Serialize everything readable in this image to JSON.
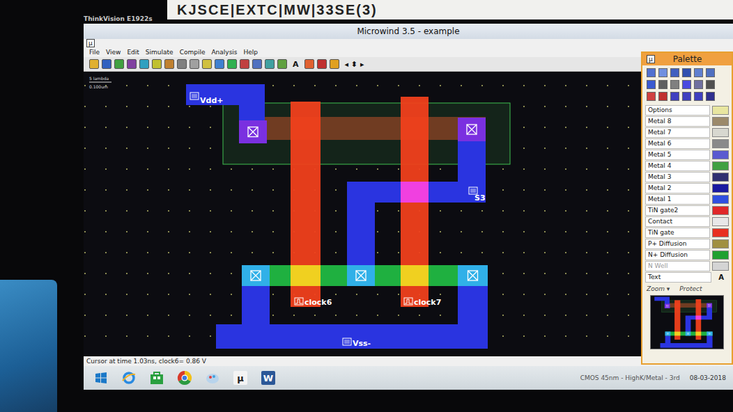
{
  "monitor": {
    "brand": "ThinkVision E1922s",
    "sticker": "KJSCE|EXTC|MW|33SE(3)"
  },
  "window": {
    "title": "Microwind 3.5 - example",
    "app_icon": "µ"
  },
  "menu": [
    "File",
    "View",
    "Edit",
    "Simulate",
    "Compile",
    "Analysis",
    "Help"
  ],
  "toolbar": [
    {
      "kind": "icon",
      "color": "#e0b030"
    },
    {
      "kind": "icon",
      "color": "#3060c0"
    },
    {
      "kind": "icon",
      "color": "#40a040"
    },
    {
      "kind": "icon",
      "color": "#8040a0"
    },
    {
      "kind": "icon",
      "color": "#30a0c0"
    },
    {
      "kind": "icon",
      "color": "#c0c030"
    },
    {
      "kind": "icon",
      "color": "#c08030"
    },
    {
      "kind": "icon",
      "color": "#808080"
    },
    {
      "kind": "icon",
      "color": "#a0a0a0"
    },
    {
      "kind": "icon",
      "color": "#d0c040"
    },
    {
      "kind": "icon",
      "color": "#4080d0"
    },
    {
      "kind": "icon",
      "color": "#30b050"
    },
    {
      "kind": "icon",
      "color": "#c04040"
    },
    {
      "kind": "icon",
      "color": "#5070c0"
    },
    {
      "kind": "icon",
      "color": "#40a0a0"
    },
    {
      "kind": "icon",
      "color": "#60a040"
    },
    {
      "kind": "text",
      "label": "A"
    },
    {
      "kind": "icon",
      "color": "#e06030"
    },
    {
      "kind": "icon",
      "color": "#c03030"
    },
    {
      "kind": "icon",
      "color": "#e0a020"
    },
    {
      "kind": "text",
      "label": "◂ ⬍ ▸"
    }
  ],
  "scale": {
    "lambda": "5 lambda",
    "length": "0.100um"
  },
  "labels": {
    "vdd": "Vdd+",
    "s3": "S3",
    "clock6": "clock6",
    "clock7": "clock7",
    "vss": "Vss-"
  },
  "palette": {
    "title": "Palette",
    "items": [
      {
        "name": "Options",
        "kind": "color",
        "color": "#e8e6a0",
        "disabled": false
      },
      {
        "name": "Metal 8",
        "kind": "color",
        "color": "#9c8a6a",
        "disabled": false
      },
      {
        "name": "Metal 7",
        "kind": "color",
        "color": "#d8d8d0",
        "disabled": false
      },
      {
        "name": "Metal 6",
        "kind": "color",
        "color": "#8a8a8a",
        "disabled": false
      },
      {
        "name": "Metal 5",
        "kind": "color",
        "color": "#5a5ad0",
        "disabled": false
      },
      {
        "name": "Metal 4",
        "kind": "color",
        "color": "#40a040",
        "disabled": false
      },
      {
        "name": "Metal 3",
        "kind": "color",
        "color": "#303070",
        "disabled": false
      },
      {
        "name": "Metal 2",
        "kind": "color",
        "color": "#1a1aa0",
        "disabled": false
      },
      {
        "name": "Metal 1",
        "kind": "color",
        "color": "#3050e0",
        "disabled": false
      },
      {
        "name": "TiN gate2",
        "kind": "color",
        "color": "#e02828",
        "disabled": false
      },
      {
        "name": "Contact",
        "kind": "color",
        "color": "#e8e8e8",
        "disabled": false
      },
      {
        "name": "TiN gate",
        "kind": "color",
        "color": "#e83020",
        "disabled": false
      },
      {
        "name": "P+ Diffusion",
        "kind": "color",
        "color": "#a09040",
        "disabled": false
      },
      {
        "name": "N+ Diffusion",
        "kind": "color",
        "color": "#20a030",
        "disabled": false
      },
      {
        "name": "N Well",
        "kind": "color",
        "color": "#d4d4d4",
        "disabled": true
      },
      {
        "name": "Text",
        "kind": "text",
        "glyph": "A",
        "disabled": false
      }
    ],
    "zoom": "Zoom ▾",
    "protect": "Protect"
  },
  "status_bar": {
    "text": "Cursor at time 1.03ns, clock6= 0.86 V"
  },
  "taskbar": {
    "apps": [
      {
        "kind": "windows"
      },
      {
        "kind": "ie"
      },
      {
        "kind": "store"
      },
      {
        "kind": "chrome"
      },
      {
        "kind": "paint"
      },
      {
        "kind": "microwind",
        "label": "µ"
      },
      {
        "kind": "word",
        "label": "W"
      }
    ],
    "technology": "CMOS 45nm - HighK/Metal - 3rd",
    "date": "08-03-2018"
  }
}
